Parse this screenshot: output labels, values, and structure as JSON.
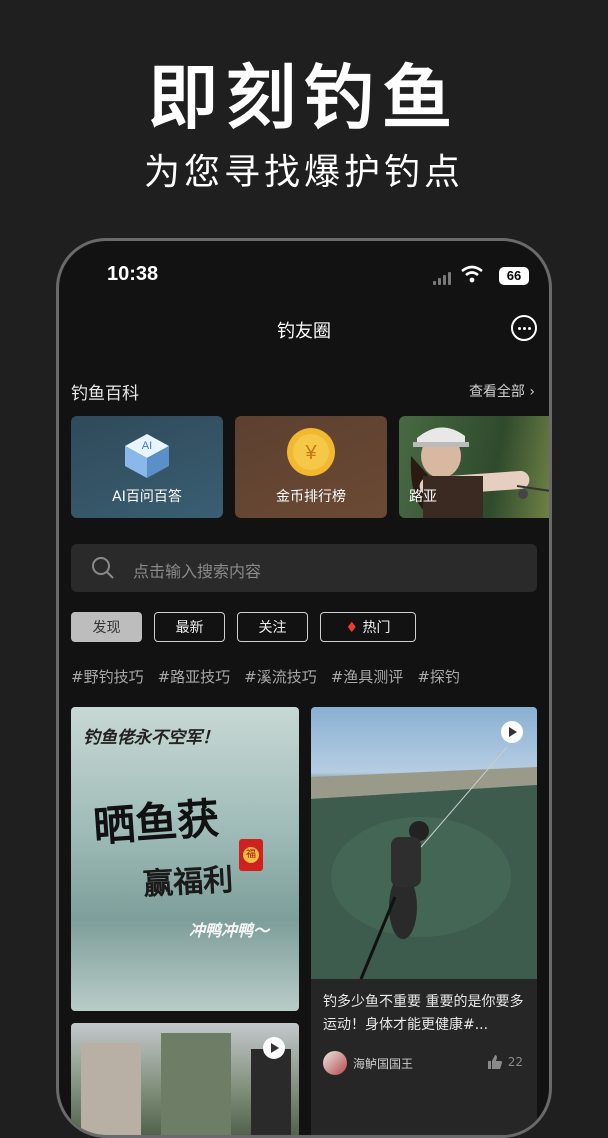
{
  "hero": {
    "title": "即刻钓鱼",
    "subtitle": "为您寻找爆护钓点"
  },
  "status_bar": {
    "time": "10:38",
    "battery": "66"
  },
  "nav": {
    "title": "钓友圈"
  },
  "wiki": {
    "title": "钓鱼百科",
    "see_all": "查看全部 ›",
    "cards": [
      {
        "label": "AI百问百答"
      },
      {
        "label": "金币排行榜"
      },
      {
        "label": "路亚"
      }
    ]
  },
  "search": {
    "placeholder": "点击输入搜索内容"
  },
  "tabs": [
    {
      "label": "发现"
    },
    {
      "label": "最新"
    },
    {
      "label": "关注"
    },
    {
      "label": "热门"
    }
  ],
  "tags": [
    "#野钓技巧",
    "#路亚技巧",
    "#溪流技巧",
    "#渔具测评",
    "#探钓"
  ],
  "feed": {
    "promo": {
      "line1": "钓鱼佬永不空军！",
      "line2": "晒鱼获",
      "line3": "赢福利",
      "line4": "冲鸭冲鸭～",
      "badge": "福"
    },
    "post": {
      "text": "钓多少鱼不重要 重要的是你要多运动！身体才能更健康#...",
      "author": "海鲈国国王",
      "likes": "22"
    }
  },
  "colors": {
    "background": "#1f1f1f",
    "phone": "#121212",
    "hot": "#e8402a"
  }
}
